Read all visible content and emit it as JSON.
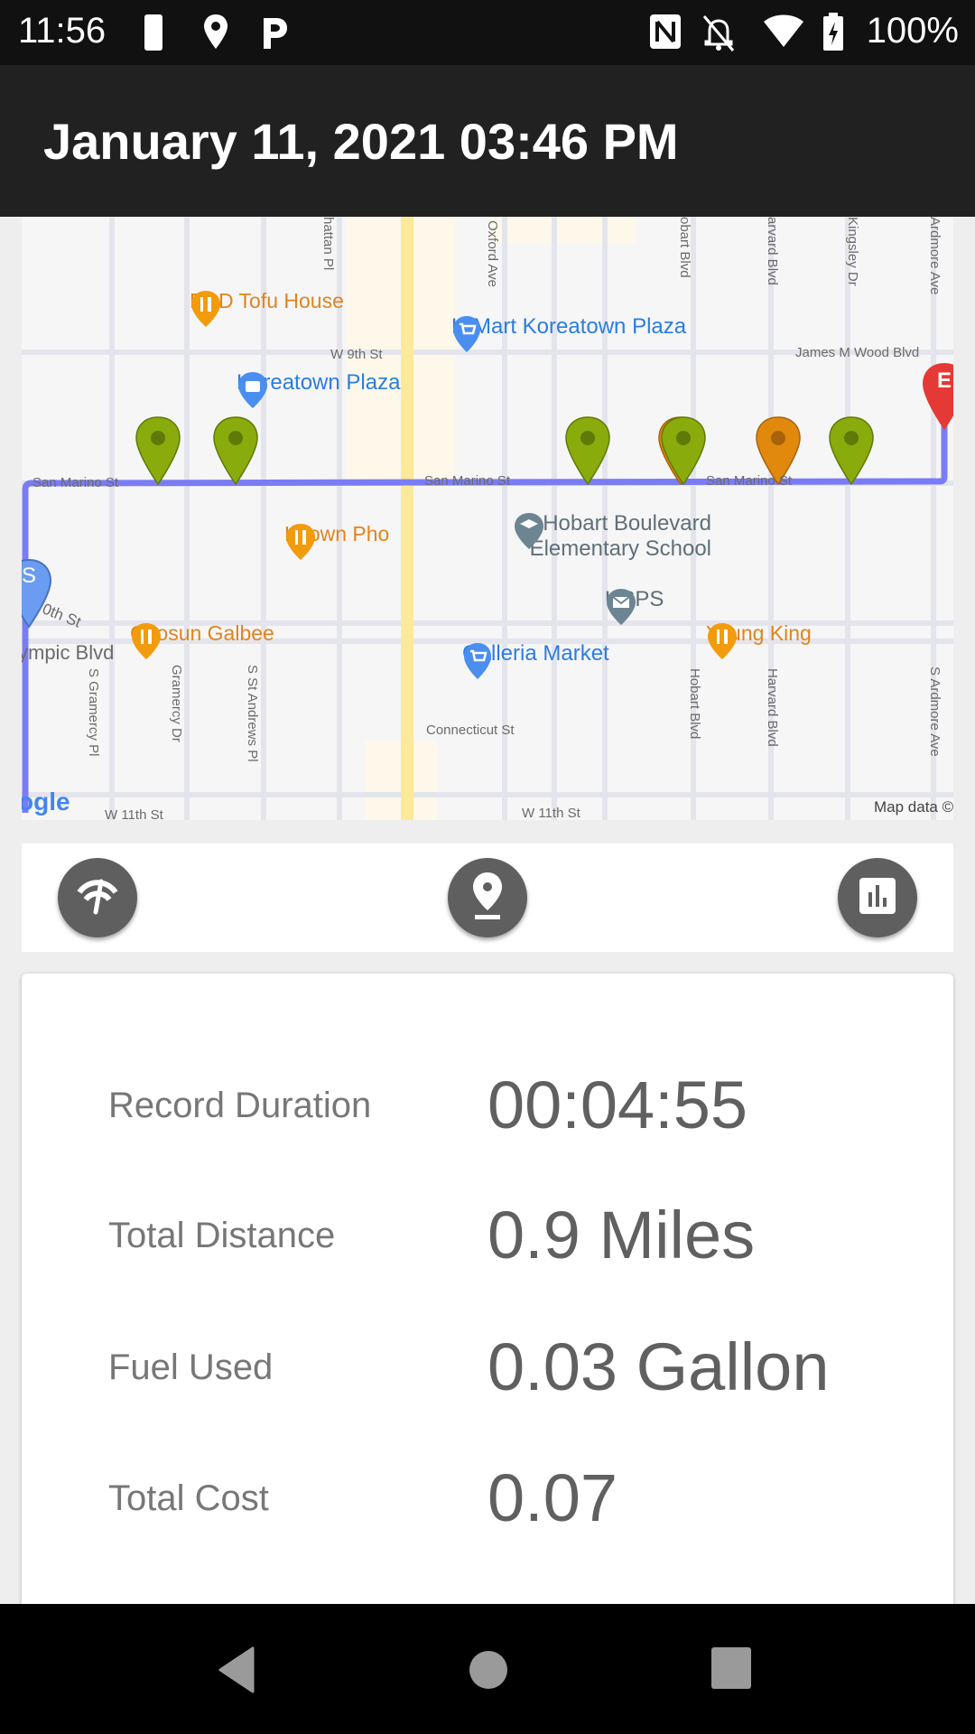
{
  "status_bar": {
    "time": "11:56",
    "left_icons": [
      "do-not-disturb-phone-icon",
      "location-icon",
      "parking-icon"
    ],
    "right_icons": [
      "nfc-icon",
      "notifications-off-icon",
      "wifi-icon",
      "battery-charging-icon"
    ],
    "battery_percent": "100%"
  },
  "header": {
    "title": "January 11, 2021 03:46 PM"
  },
  "map": {
    "pois": [
      {
        "name": "BCD Tofu House",
        "type": "restaurant"
      },
      {
        "name": "H Mart Koreatown Plaza",
        "type": "shopping-cart"
      },
      {
        "name": "Koreatown Plaza",
        "type": "shopping-bag"
      },
      {
        "name": "KTown Pho",
        "type": "restaurant"
      },
      {
        "name": "Hobart Boulevard Elementary School",
        "type": "school"
      },
      {
        "name": "USPS",
        "type": "post-office"
      },
      {
        "name": "Chosun Galbee",
        "type": "restaurant"
      },
      {
        "name": "Young King",
        "type": "restaurant"
      },
      {
        "name": "Galleria Market",
        "type": "shopping-cart"
      }
    ],
    "streets": {
      "w9th": "W 9th St",
      "san_marino_1": "San Marino St",
      "san_marino_2": "San Marino St",
      "san_marino_3": "San Marino St",
      "james_wood": "James M Wood Blvd",
      "olympic": "ympic Blvd",
      "tenth": "0th St",
      "connecticut": "Connecticut St",
      "w11th_1": "W 11th St",
      "w11th_2": "W 11th St",
      "manhattan": "hattan Pl",
      "oxford": "Oxford Ave",
      "hobart_top": "obart Blvd",
      "harvard_top": "arvard Blvd",
      "kingsley": "Kingsley Dr",
      "ardmore_top": "Ardmore Ave",
      "s_gramercy_pl": "S Gramercy Pl",
      "gramercy_dr": "Gramercy Dr",
      "s_st_andrews": "S St Andrews Pl",
      "hobart_bottom": "Hobart Blvd",
      "harvard_bottom": "Harvard Blvd",
      "s_ardmore": "S Ardmore Ave"
    },
    "start_marker_label": "S",
    "end_marker_label": "E",
    "route_markers": [
      {
        "status": "green"
      },
      {
        "status": "green"
      },
      {
        "status": "green"
      },
      {
        "status": "orange"
      },
      {
        "status": "green"
      },
      {
        "status": "orange"
      },
      {
        "status": "green"
      }
    ],
    "attribution_logo": "ogle",
    "attribution_text": "Map data ©",
    "colors": {
      "route": "#7a7cf5",
      "marker_green": "#8aab0c",
      "marker_orange": "#e0890d",
      "marker_end": "#e53935",
      "marker_start": "#6a9cf2",
      "arterial": "#fce99a"
    }
  },
  "actions": {
    "speed_button_icon": "speedometer-icon",
    "location_button_icon": "place-marker-icon",
    "stats_button_icon": "bar-chart-icon"
  },
  "stats": [
    {
      "label": "Record Duration",
      "value": "00:04:55"
    },
    {
      "label": "Total Distance",
      "value": "0.9 Miles"
    },
    {
      "label": "Fuel Used",
      "value": "0.03 Gallon"
    },
    {
      "label": "Total Cost",
      "value": "0.07"
    }
  ],
  "nav_bar": {
    "back_icon": "back-triangle-icon",
    "home_icon": "home-circle-icon",
    "recents_icon": "recents-square-icon"
  }
}
